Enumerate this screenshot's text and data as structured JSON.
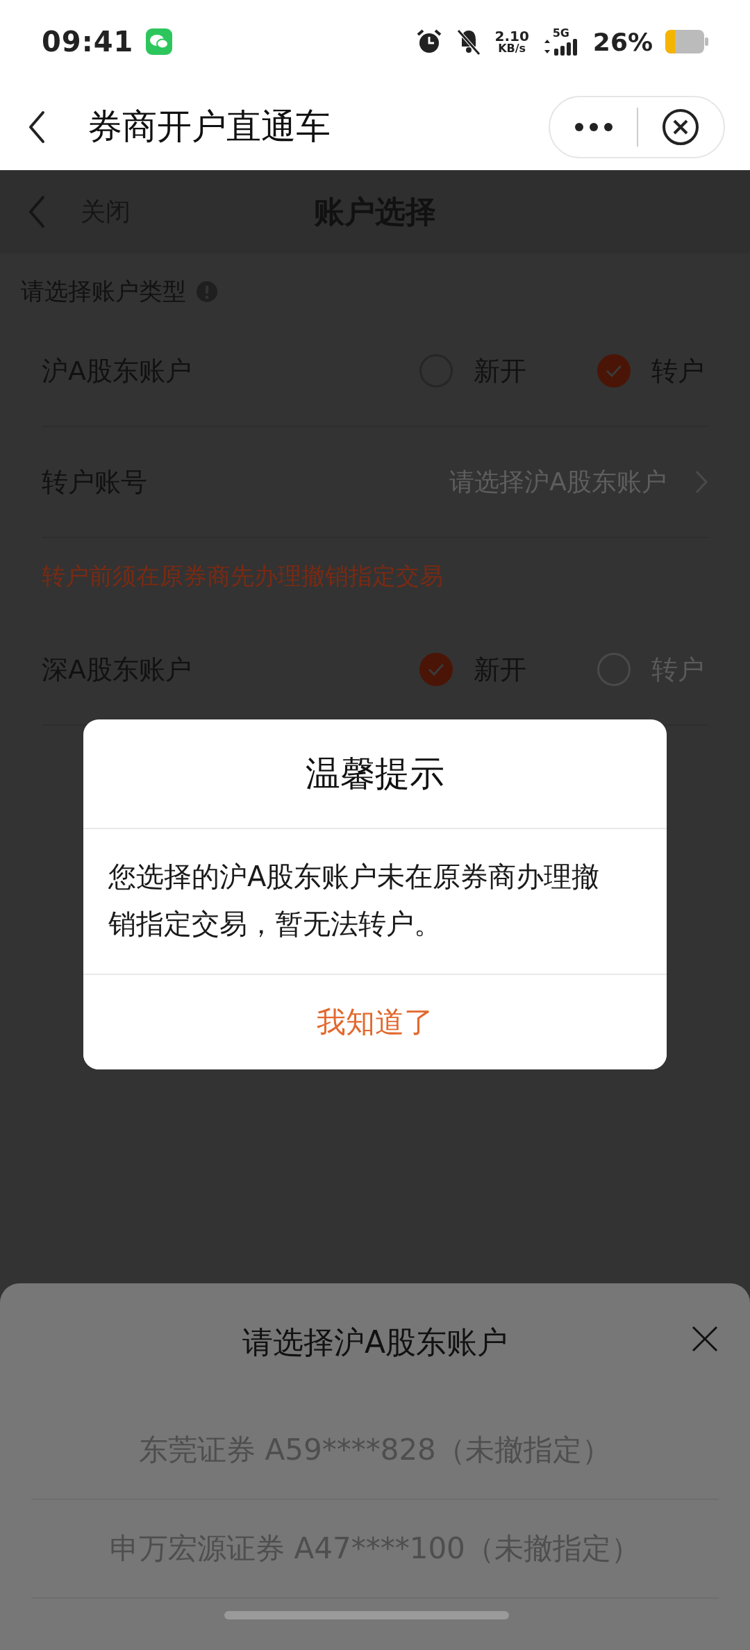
{
  "status_bar": {
    "time": "09:41",
    "speed": "2.10",
    "speed_unit": "KB/s",
    "network": "5G",
    "battery": "26%"
  },
  "nav_bar": {
    "title": "券商开户直通车"
  },
  "page_header": {
    "back_label": "关闭",
    "title": "账户选择"
  },
  "section_label": "请选择账户类型",
  "rows": [
    {
      "kind": "account",
      "name": "沪A股东账户",
      "options": [
        {
          "label": "新开",
          "selected": false,
          "disabled": false
        },
        {
          "label": "转户",
          "selected": true,
          "disabled": false
        }
      ]
    },
    {
      "kind": "picker",
      "label": "转户账号",
      "placeholder": "请选择沪A股东账户"
    },
    {
      "kind": "warning",
      "text": "转户前须在原券商先办理撤销指定交易"
    },
    {
      "kind": "account",
      "name": "深A股东账户",
      "options": [
        {
          "label": "新开",
          "selected": true,
          "disabled": false
        },
        {
          "label": "转户",
          "selected": false,
          "disabled": true
        }
      ]
    }
  ],
  "dialog": {
    "title": "温馨提示",
    "message": "您选择的沪A股东账户未在原券商办理撤销指定交易，暂无法转户。",
    "button": "我知道了"
  },
  "sheet": {
    "title": "请选择沪A股东账户",
    "items": [
      "东莞证券 A59****828（未撤指定）",
      "申万宏源证券 A47****100（未撤指定）"
    ]
  }
}
